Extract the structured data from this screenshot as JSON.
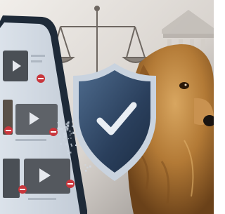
{
  "image": {
    "alt": "",
    "colors": {
      "background_light": "#e9e5e1",
      "background_dark": "#8f8a86",
      "courthouse": "#cbc6c0",
      "scales": "#6e6761",
      "phone_body": "#1e2a38",
      "phone_screen": "#d4dce6",
      "thumbnail_dark": "#4a4f55",
      "block_badge": "#c8363c",
      "shield_dark": "#1c2d44",
      "shield_light": "#4d6a8c",
      "shield_rim": "#c9d3df",
      "checkmark": "#e9eef4",
      "particles": "#cfd8e3",
      "dog_fur_light": "#c9954e",
      "dog_fur_mid": "#a8702f",
      "dog_fur_dark": "#6a4119"
    }
  }
}
